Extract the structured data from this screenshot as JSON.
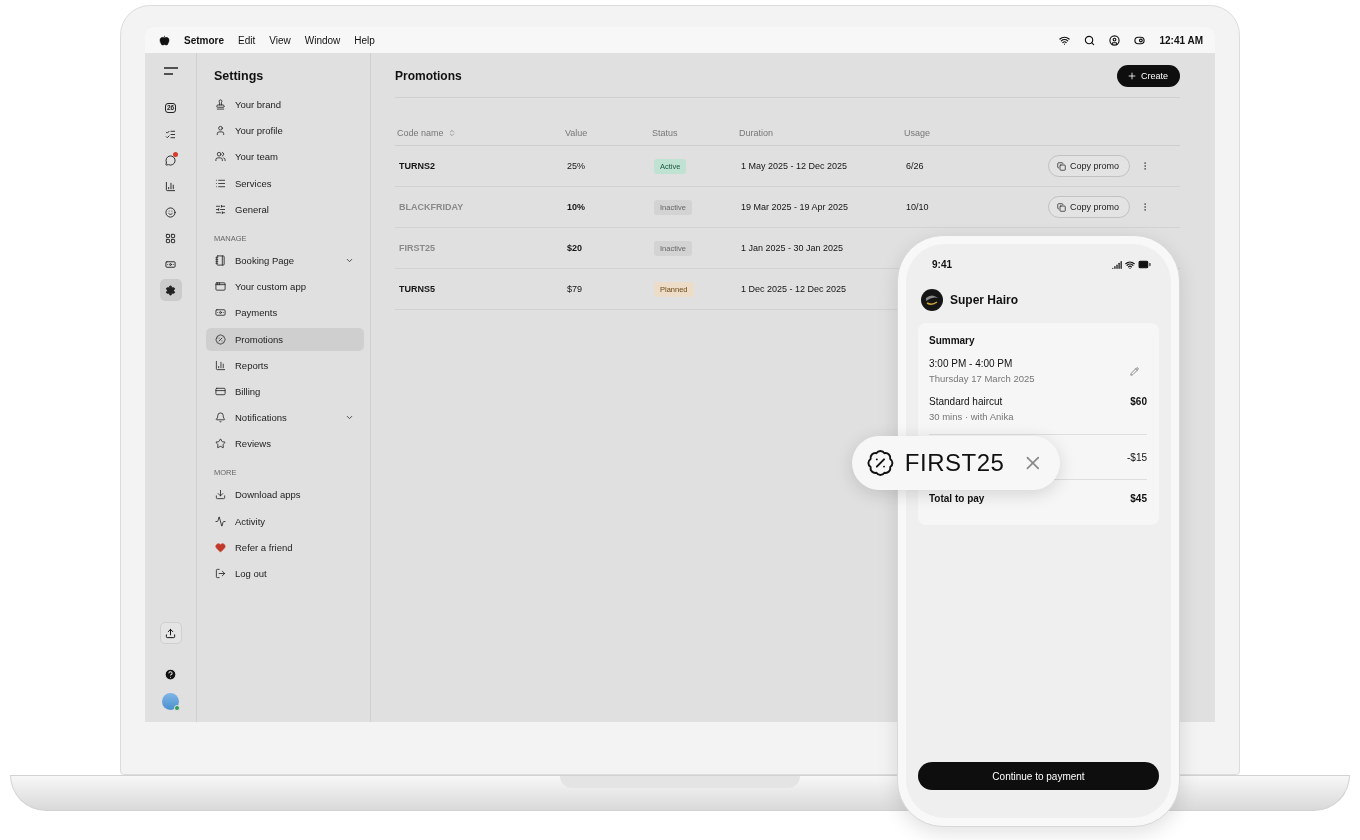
{
  "menu_bar": {
    "app": "Setmore",
    "menus": [
      "Edit",
      "View",
      "Window",
      "Help"
    ],
    "clock": "12:41 AM"
  },
  "rail": {
    "calendar_day": "26",
    "items": [
      {
        "selected": false,
        "notification": false
      },
      {
        "selected": false,
        "notification": false
      },
      {
        "selected": false,
        "notification": true
      },
      {
        "selected": false,
        "notification": false
      },
      {
        "selected": false,
        "notification": false
      },
      {
        "selected": false,
        "notification": false
      },
      {
        "selected": false,
        "notification": false
      },
      {
        "selected": true,
        "notification": false
      }
    ],
    "avatar": {
      "online": true
    }
  },
  "settings": {
    "title": "Settings",
    "groups": [
      {
        "items": [
          {
            "label": "Your brand",
            "selected": false,
            "expandable": false
          },
          {
            "label": "Your profile",
            "selected": false,
            "expandable": false
          },
          {
            "label": "Your team",
            "selected": false,
            "expandable": false
          },
          {
            "label": "Services",
            "selected": false,
            "expandable": false
          },
          {
            "label": "General",
            "selected": false,
            "expandable": false
          }
        ]
      },
      {
        "heading": "MANAGE",
        "items": [
          {
            "label": "Booking Page",
            "selected": false,
            "expandable": true
          },
          {
            "label": "Your custom app",
            "selected": false,
            "expandable": false
          },
          {
            "label": "Payments",
            "selected": false,
            "expandable": false
          },
          {
            "label": "Promotions",
            "selected": true,
            "expandable": false
          },
          {
            "label": "Reports",
            "selected": false,
            "expandable": false
          },
          {
            "label": "Billing",
            "selected": false,
            "expandable": false
          },
          {
            "label": "Notifications",
            "selected": false,
            "expandable": true
          },
          {
            "label": "Reviews",
            "selected": false,
            "expandable": false
          }
        ]
      },
      {
        "heading": "MORE",
        "items": [
          {
            "label": "Download apps",
            "selected": false,
            "expandable": false
          },
          {
            "label": "Activity",
            "selected": false,
            "expandable": false
          },
          {
            "label": "Refer a friend",
            "selected": false,
            "expandable": false
          },
          {
            "label": "Log out",
            "selected": false,
            "expandable": false
          }
        ]
      }
    ]
  },
  "page": {
    "title": "Promotions",
    "create_button": "Create"
  },
  "table": {
    "columns": [
      "Code name",
      "Value",
      "Status",
      "Duration",
      "Usage"
    ],
    "rows": [
      {
        "code": "TURNS2",
        "dimmed": false,
        "value": "25%",
        "value_bold": false,
        "status": {
          "label": "Active",
          "kind": "active"
        },
        "duration": "1 May 2025 - 12 Dec 2025",
        "usage": "6/26",
        "action": "Copy promo"
      },
      {
        "code": "BLACKFRIDAY",
        "dimmed": true,
        "value": "10%",
        "value_bold": true,
        "status": {
          "label": "Inactive",
          "kind": "inactive"
        },
        "duration": "19 Mar 2025 - 19 Apr 2025",
        "usage": "10/10",
        "action": "Copy promo"
      },
      {
        "code": "FIRST25",
        "dimmed": true,
        "value": "$20",
        "value_bold": true,
        "status": {
          "label": "Inactive",
          "kind": "inactive"
        },
        "duration": "1 Jan 2025 - 30 Jan 2025"
      },
      {
        "code": "TURNS5",
        "dimmed": false,
        "value": "$79",
        "value_bold": false,
        "status": {
          "label": "Planned",
          "kind": "planned"
        },
        "duration": "1 Dec 2025 - 12 Dec 2025"
      }
    ]
  },
  "phone": {
    "time": "9:41",
    "shop": "Super Hairo",
    "summary": {
      "title": "Summary",
      "time_range": "3:00 PM - 4:00 PM",
      "date": "Thursday 17 March 2025",
      "service": "Standard haircut",
      "service_price": "$60",
      "service_detail": "30 mins · with Anika",
      "discount": "-$15",
      "total_label": "Total to pay",
      "total": "$45"
    },
    "button": "Continue to payment"
  },
  "promo_chip": {
    "code": "FIRST25"
  }
}
